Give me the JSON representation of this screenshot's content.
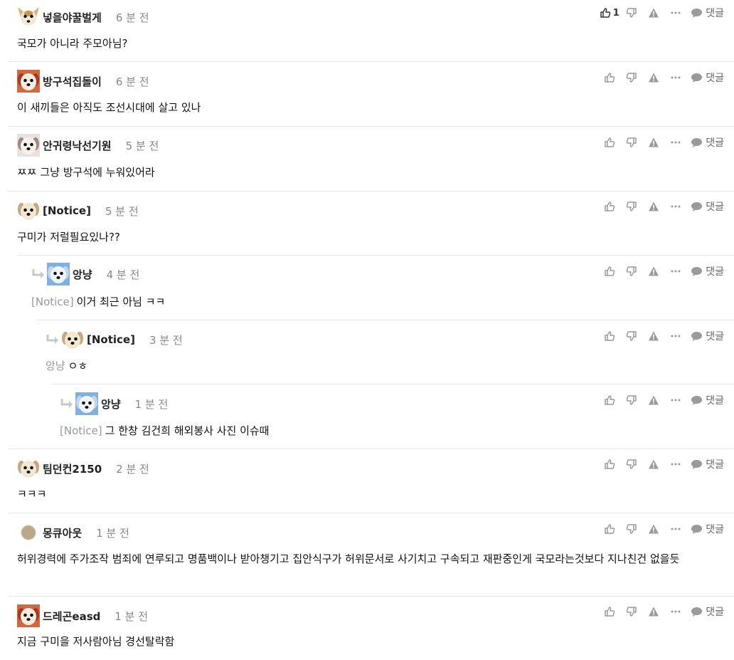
{
  "comments": [
    {
      "author": "넣을야꿀벌게",
      "time": "6 분 전",
      "text": "국모가 아니라 주모아님?",
      "likes": "1",
      "avatar": "chihuahua"
    },
    {
      "author": "방구석집돌이",
      "time": "6 분 전",
      "text": "이 새끼들은 아직도 조선시대에 살고 있나",
      "likes": "",
      "avatar": "dog-red"
    },
    {
      "author": "안귀령낙선기원",
      "time": "5 분 전",
      "text": "ㅉㅉ 그냥 방구석에 누워있어라",
      "likes": "",
      "avatar": "dog-white"
    },
    {
      "author": "[Notice]",
      "time": "5 분 전",
      "text": "구미가 저럴필요있나??",
      "likes": "",
      "avatar": "dog-cream"
    },
    {
      "author": "앙냥",
      "time": "4 분 전",
      "mention": "[Notice]",
      "text": "이거 최근 아님 ㅋㅋ",
      "likes": "",
      "avatar": "dog-blue"
    },
    {
      "author": "[Notice]",
      "time": "3 분 전",
      "mention": "앙냥",
      "text": "ㅇㅎ",
      "likes": "",
      "avatar": "dog-cream"
    },
    {
      "author": "앙냥",
      "time": "1 분 전",
      "mention": "[Notice]",
      "text": "그 한창 김건희 해외봉사 사진 이슈때",
      "likes": "",
      "avatar": "dog-blue"
    },
    {
      "author": "팀던컨2150",
      "time": "2 분 전",
      "text": "ㅋㅋㅋ",
      "likes": "",
      "avatar": "dog-cream"
    },
    {
      "author": "몽큐아웃",
      "time": "1 분 전",
      "text": "허위경력에 주가조작 범죄에 연루되고 명품백이나 받아챙기고 집안식구가 허위문서로 사기치고 구속되고 재판중인게 국모라는것보다 지나친건 없을듯",
      "likes": "",
      "avatar": "circle-tan"
    },
    {
      "author": "드레곤easd",
      "time": "1 분 전",
      "text": "지금 구미을 저사람아님 경선탈락함",
      "likes": "",
      "avatar": "dog-red"
    }
  ],
  "labels": {
    "reply": "댓글"
  },
  "icons": {
    "like": "thumbs-up-icon",
    "dislike": "thumbs-down-icon",
    "report": "warning-icon",
    "more": "more-icon",
    "reply": "comment-icon"
  },
  "colors": {
    "icon": "#9a9a9a",
    "separator": "#e6e6e6",
    "time": "#888888",
    "mention": "#999999"
  }
}
